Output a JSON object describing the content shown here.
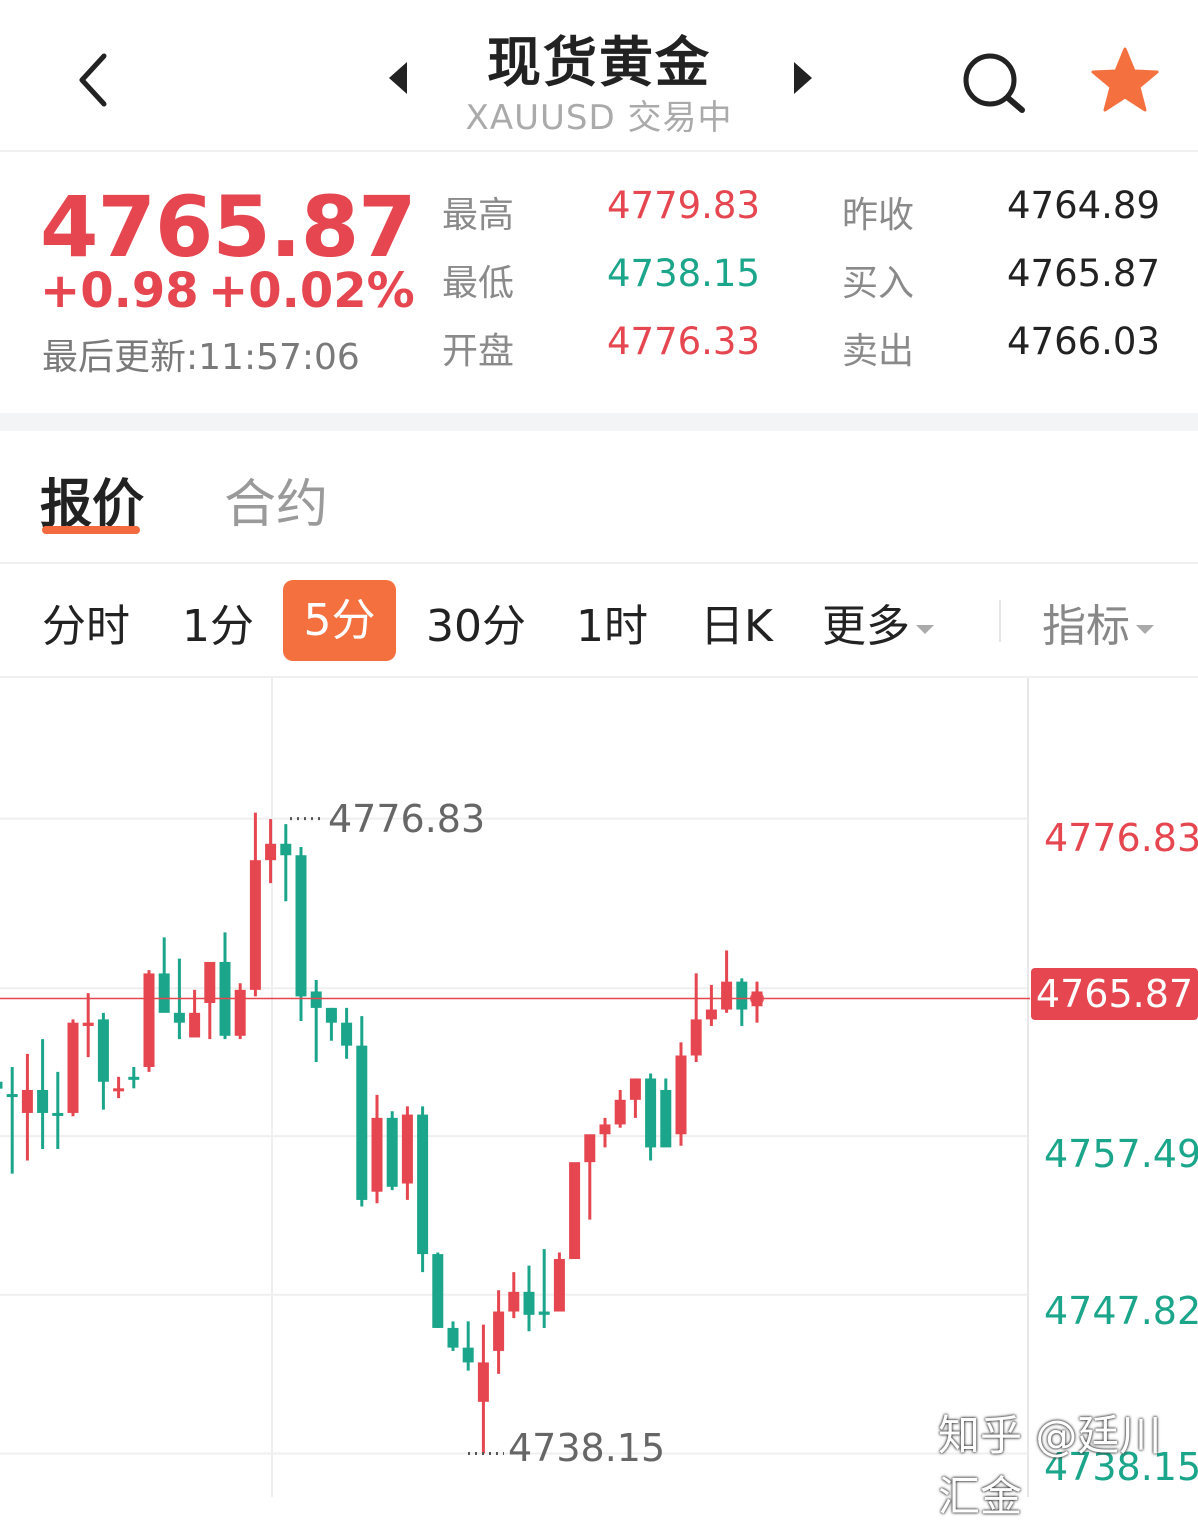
{
  "header": {
    "title": "现货黄金",
    "subtitle": "XAUUSD 交易中"
  },
  "quote": {
    "price": "4765.87",
    "change": "+0.98",
    "change_pct": "+0.02%",
    "last_update": "最后更新:11:57:06",
    "stats": {
      "high_label": "最高",
      "high": "4779.83",
      "low_label": "最低",
      "low": "4738.15",
      "open_label": "开盘",
      "open": "4776.33",
      "prev_close_label": "昨收",
      "prev_close": "4764.89",
      "bid_label": "买入",
      "bid": "4765.87",
      "ask_label": "卖出",
      "ask": "4766.03"
    }
  },
  "tabs": [
    {
      "label": "报价",
      "active": true
    },
    {
      "label": "合约",
      "active": false
    }
  ],
  "periods": [
    {
      "label": "分时"
    },
    {
      "label": "1分"
    },
    {
      "label": "5分",
      "active": true
    },
    {
      "label": "30分"
    },
    {
      "label": "1时"
    },
    {
      "label": "日K"
    },
    {
      "label": "更多"
    }
  ],
  "indicator_label": "指标",
  "colors": {
    "up": "#e5464f",
    "down": "#1ba58a",
    "accent": "#f4703f"
  },
  "chart_data": {
    "type": "candlestick",
    "y_axis_ticks": [
      "4776.83",
      "4757.49",
      "4747.82",
      "4738.15"
    ],
    "current_price": "4765.87",
    "high_marker": "4776.83",
    "low_marker": "4738.15",
    "ylim": [
      4735.5,
      4785.4
    ],
    "candles": [
      {
        "o": 4760.8,
        "h": 4761.7,
        "l": 4756.8,
        "c": 4760.38,
        "up": false
      },
      {
        "o": 4760.05,
        "h": 4761.7,
        "l": 4755.2,
        "c": 4760.05,
        "up": false
      },
      {
        "o": 4758.9,
        "h": 4762.5,
        "l": 4756.0,
        "c": 4760.3,
        "up": true
      },
      {
        "o": 4760.3,
        "h": 4763.4,
        "l": 4756.7,
        "c": 4758.9,
        "up": false
      },
      {
        "o": 4758.9,
        "h": 4761.4,
        "l": 4756.7,
        "c": 4758.9,
        "up": false
      },
      {
        "o": 4758.9,
        "h": 4764.6,
        "l": 4758.7,
        "c": 4764.4,
        "up": true
      },
      {
        "o": 4764.2,
        "h": 4766.2,
        "l": 4762.3,
        "c": 4764.4,
        "up": true
      },
      {
        "o": 4764.6,
        "h": 4765.0,
        "l": 4759.1,
        "c": 4760.8,
        "up": false
      },
      {
        "o": 4760.4,
        "h": 4761.1,
        "l": 4759.8,
        "c": 4760.4,
        "up": true
      },
      {
        "o": 4761.1,
        "h": 4761.7,
        "l": 4760.4,
        "c": 4761.1,
        "up": false
      },
      {
        "o": 4761.7,
        "h": 4767.6,
        "l": 4761.4,
        "c": 4767.4,
        "up": true
      },
      {
        "o": 4767.4,
        "h": 4769.6,
        "l": 4765.6,
        "c": 4765.0,
        "up": false
      },
      {
        "o": 4765.0,
        "h": 4768.3,
        "l": 4763.4,
        "c": 4764.4,
        "up": false
      },
      {
        "o": 4763.5,
        "h": 4766.4,
        "l": 4763.5,
        "c": 4765.0,
        "up": true
      },
      {
        "o": 4765.6,
        "h": 4767.1,
        "l": 4763.4,
        "c": 4768.1,
        "up": true
      },
      {
        "o": 4768.1,
        "h": 4769.9,
        "l": 4763.4,
        "c": 4763.6,
        "up": false
      },
      {
        "o": 4763.6,
        "h": 4766.8,
        "l": 4763.4,
        "c": 4766.4,
        "up": true
      },
      {
        "o": 4766.4,
        "h": 4777.2,
        "l": 4766.0,
        "c": 4774.3,
        "up": true
      },
      {
        "o": 4774.3,
        "h": 4776.8,
        "l": 4772.9,
        "c": 4775.3,
        "up": true
      },
      {
        "o": 4775.3,
        "h": 4776.5,
        "l": 4771.8,
        "c": 4774.6,
        "up": false
      },
      {
        "o": 4774.6,
        "h": 4775.1,
        "l": 4764.5,
        "c": 4766.0,
        "up": false
      },
      {
        "o": 4766.3,
        "h": 4767.0,
        "l": 4762.0,
        "c": 4765.3,
        "up": false
      },
      {
        "o": 4765.3,
        "h": 4765.3,
        "l": 4763.3,
        "c": 4764.4,
        "up": false
      },
      {
        "o": 4764.4,
        "h": 4765.3,
        "l": 4762.2,
        "c": 4763.0,
        "up": false
      },
      {
        "o": 4763.0,
        "h": 4764.8,
        "l": 4753.2,
        "c": 4753.6,
        "up": false
      },
      {
        "o": 4754.1,
        "h": 4760.0,
        "l": 4753.4,
        "c": 4758.6,
        "up": true
      },
      {
        "o": 4758.6,
        "h": 4759.0,
        "l": 4754.2,
        "c": 4754.4,
        "up": false
      },
      {
        "o": 4754.6,
        "h": 4759.3,
        "l": 4753.6,
        "c": 4758.8,
        "up": true
      },
      {
        "o": 4758.8,
        "h": 4759.3,
        "l": 4749.2,
        "c": 4750.3,
        "up": false
      },
      {
        "o": 4750.3,
        "h": 4750.4,
        "l": 4745.8,
        "c": 4745.8,
        "up": false
      },
      {
        "o": 4745.8,
        "h": 4746.2,
        "l": 4744.4,
        "c": 4744.6,
        "up": false
      },
      {
        "o": 4744.6,
        "h": 4746.2,
        "l": 4743.2,
        "c": 4743.7,
        "up": false
      },
      {
        "o": 4743.7,
        "h": 4746.0,
        "l": 4738.15,
        "c": 4741.3,
        "up": true
      },
      {
        "o": 4744.4,
        "h": 4748.1,
        "l": 4743.0,
        "c": 4746.8,
        "up": true
      },
      {
        "o": 4746.8,
        "h": 4749.2,
        "l": 4746.4,
        "c": 4748.0,
        "up": true
      },
      {
        "o": 4748.0,
        "h": 4749.6,
        "l": 4745.6,
        "c": 4746.6,
        "up": false
      },
      {
        "o": 4746.6,
        "h": 4750.6,
        "l": 4745.8,
        "c": 4746.8,
        "up": false
      },
      {
        "o": 4746.8,
        "h": 4750.4,
        "l": 4747.0,
        "c": 4750.0,
        "up": true
      },
      {
        "o": 4750.0,
        "h": 4754.0,
        "l": 4753.4,
        "c": 4755.9,
        "up": true
      },
      {
        "o": 4755.9,
        "h": 4757.2,
        "l": 4752.4,
        "c": 4757.6,
        "up": true
      },
      {
        "o": 4757.6,
        "h": 4758.6,
        "l": 4756.8,
        "c": 4758.2,
        "up": true
      },
      {
        "o": 4758.2,
        "h": 4760.3,
        "l": 4758.0,
        "c": 4759.7,
        "up": true
      },
      {
        "o": 4759.7,
        "h": 4761.0,
        "l": 4758.6,
        "c": 4761.0,
        "up": true
      },
      {
        "o": 4761.0,
        "h": 4761.3,
        "l": 4756.0,
        "c": 4756.8,
        "up": false
      },
      {
        "o": 4756.8,
        "h": 4761.0,
        "l": 4757.6,
        "c": 4760.3,
        "up": false
      },
      {
        "o": 4757.6,
        "h": 4763.2,
        "l": 4756.9,
        "c": 4762.4,
        "up": true
      },
      {
        "o": 4762.4,
        "h": 4767.4,
        "l": 4762.0,
        "c": 4764.6,
        "up": true
      },
      {
        "o": 4764.6,
        "h": 4766.7,
        "l": 4764.2,
        "c": 4765.2,
        "up": true
      },
      {
        "o": 4765.2,
        "h": 4768.8,
        "l": 4765.0,
        "c": 4766.9,
        "up": true
      },
      {
        "o": 4766.9,
        "h": 4767.1,
        "l": 4764.2,
        "c": 4765.2,
        "up": false
      },
      {
        "o": 4765.4,
        "h": 4766.9,
        "l": 4764.4,
        "c": 4766.3,
        "up": true
      }
    ]
  },
  "watermark": "知乎 @廷川汇金"
}
